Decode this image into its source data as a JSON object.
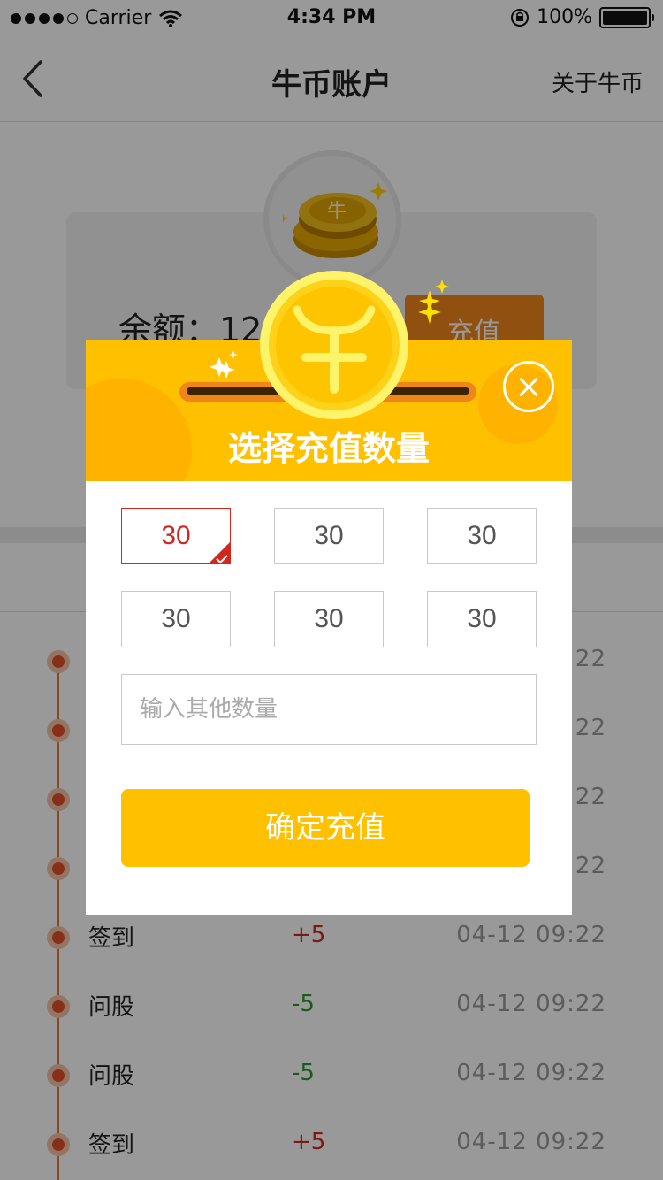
{
  "status_bar": {
    "carrier": "Carrier",
    "time": "4:34 PM",
    "battery": "100%",
    "signal_bars": 4
  },
  "nav": {
    "title": "牛币账户",
    "right_link": "关于牛币"
  },
  "account": {
    "balance_text": "余额：12",
    "recharge_button": "充值"
  },
  "records": [
    {
      "name": "",
      "amount": "",
      "time": ":22",
      "type": "plus"
    },
    {
      "name": "",
      "amount": "",
      "time": ":22",
      "type": "plus"
    },
    {
      "name": "",
      "amount": "",
      "time": ":22",
      "type": "plus"
    },
    {
      "name": "",
      "amount": "",
      "time": ":22",
      "type": "plus"
    },
    {
      "name": "签到",
      "amount": "+5",
      "time": "04-12 09:22",
      "type": "plus"
    },
    {
      "name": "问股",
      "amount": "-5",
      "time": "04-12 09:22",
      "type": "minus"
    },
    {
      "name": "问股",
      "amount": "-5",
      "time": "04-12 09:22",
      "type": "minus"
    },
    {
      "name": "签到",
      "amount": "+5",
      "time": "04-12 09:22",
      "type": "plus"
    }
  ],
  "modal": {
    "title": "选择充值数量",
    "options": [
      "30",
      "30",
      "30",
      "30",
      "30",
      "30"
    ],
    "selected_option": 1,
    "input_placeholder": "输入其他数量",
    "input_value": "",
    "confirm_button": "确定充值"
  },
  "colors": {
    "accent": "#ffc000",
    "selected": "#d0281e",
    "plus": "#d0281e",
    "minus": "#2a9a2a",
    "orange": "#f08519"
  }
}
